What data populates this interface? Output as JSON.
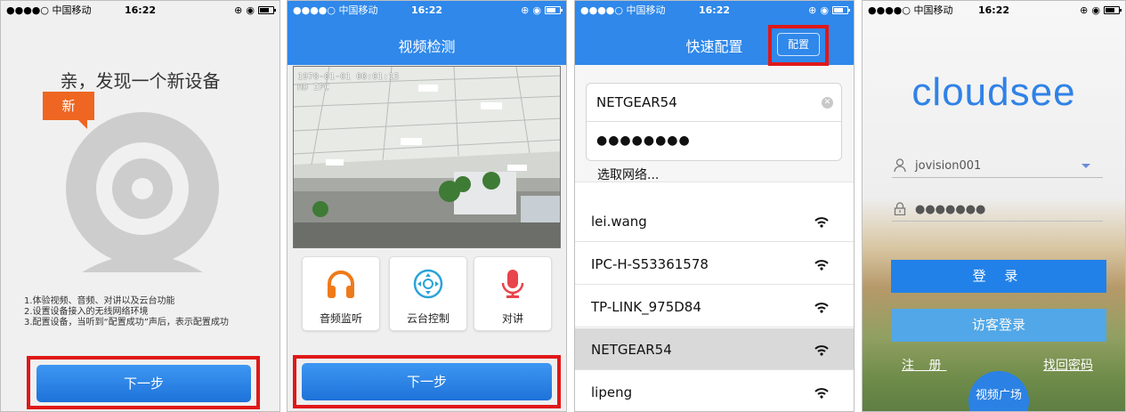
{
  "status_bar": {
    "carrier": "●●●●○ 中国移动",
    "time": "16:22"
  },
  "panel1": {
    "headline": "亲，发现一个新设备",
    "badge": "新",
    "steps": [
      "1.体验视频、音频、对讲以及云台功能",
      "2.设置设备接入的无线网络环境",
      "3.配置设备，当听到“配置成功”声后，表示配置成功"
    ],
    "next_label": "下一步"
  },
  "panel2": {
    "title": "视频检测",
    "osd_line1": "1970-01-01 00:01:15",
    "osd_line2": "HD IPC",
    "controls": [
      {
        "label": "音频监听",
        "icon": "headphones-icon"
      },
      {
        "label": "云台控制",
        "icon": "ptz-control-icon"
      },
      {
        "label": "对讲",
        "icon": "microphone-icon"
      }
    ],
    "next_label": "下一步"
  },
  "panel3": {
    "title": "快速配置",
    "config_label": "配置",
    "ssid_value": "NETGEAR54",
    "password_value": "●●●●●●●●",
    "choose_label": "选取网络...",
    "networks": [
      {
        "name": "lei.wang",
        "selected": false
      },
      {
        "name": "IPC-H-S53361578",
        "selected": false
      },
      {
        "name": "TP-LINK_975D84",
        "selected": false
      },
      {
        "name": "NETGEAR54",
        "selected": true
      },
      {
        "name": "lipeng",
        "selected": false
      }
    ]
  },
  "panel4": {
    "logo": "cloudsee",
    "username": "jovision001",
    "password": "●●●●●●●",
    "login_label": "登 录",
    "guest_label": "访客登录",
    "register_label": "注 册",
    "forgot_label": "找回密码",
    "plaza_label": "视频广场"
  },
  "colors": {
    "nav_blue": "#2f88ea",
    "highlight_red": "#e01818",
    "badge_orange": "#ee6622"
  }
}
